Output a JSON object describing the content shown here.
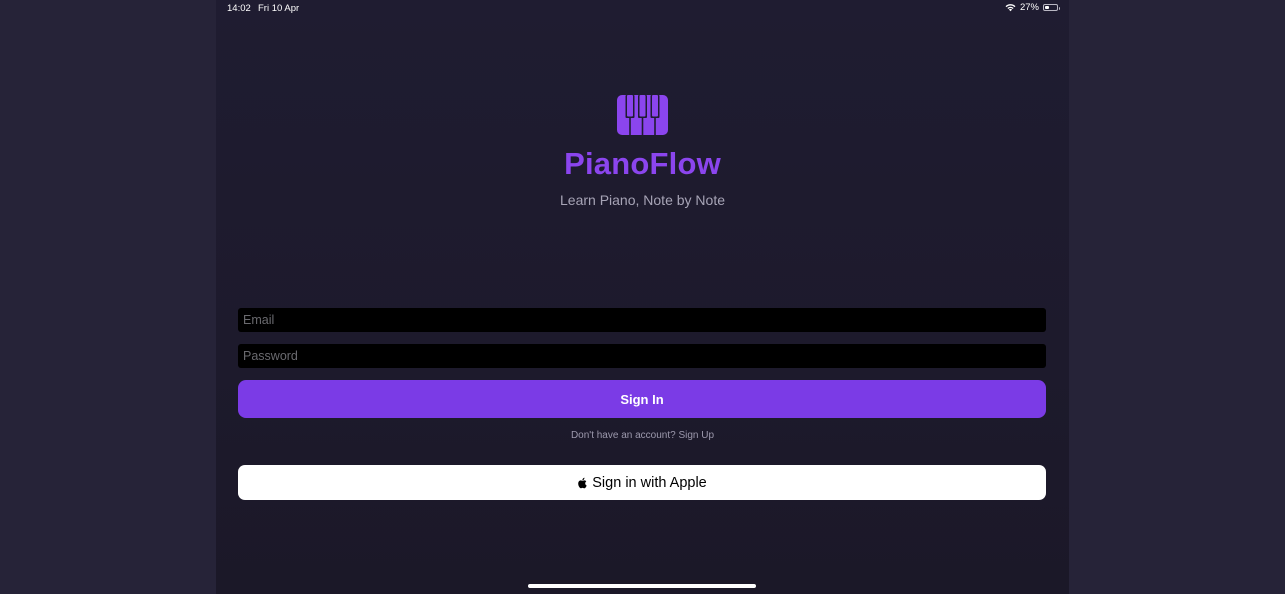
{
  "status_bar": {
    "time": "14:02",
    "date": "Fri 10 Apr",
    "battery_percent": "27%",
    "battery_level": 0.27
  },
  "app": {
    "logo_icon": "piano-keys-icon",
    "title": "PianoFlow",
    "subtitle": "Learn Piano, Note by Note"
  },
  "form": {
    "email": {
      "placeholder": "Email",
      "value": ""
    },
    "password": {
      "placeholder": "Password",
      "value": ""
    },
    "sign_in_label": "Sign In",
    "sign_up_prompt": "Don't have an account? Sign Up",
    "apple_label": "Sign in with Apple",
    "apple_icon": "apple-logo-icon"
  },
  "colors": {
    "background": "#1e1b2e",
    "accent": "#7b3be6",
    "title": "#8b45ee"
  }
}
